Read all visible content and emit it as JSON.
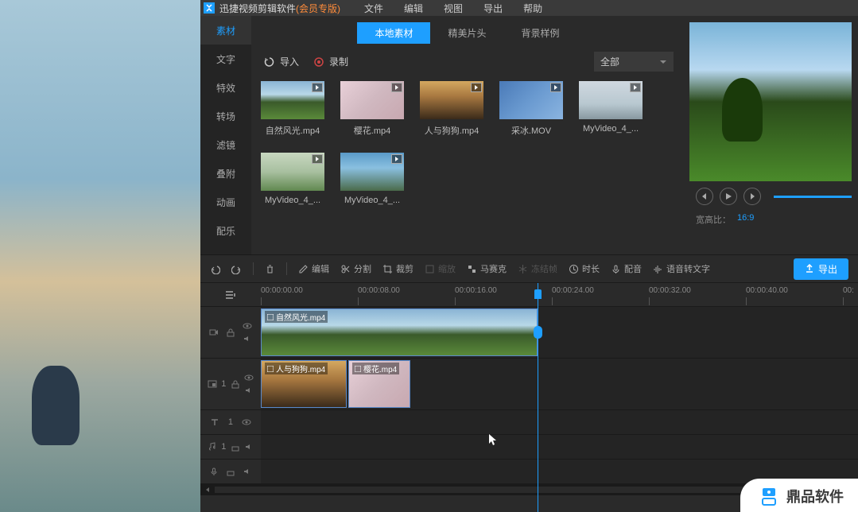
{
  "titlebar": {
    "app_name": "迅捷视频剪辑软件",
    "member": " (会员专版)"
  },
  "menu": [
    "文件",
    "编辑",
    "视图",
    "导出",
    "帮助"
  ],
  "sidetabs": [
    "素材",
    "文字",
    "特效",
    "转场",
    "滤镜",
    "叠附",
    "动画",
    "配乐"
  ],
  "subtabs": [
    "本地素材",
    "精美片头",
    "背景样例"
  ],
  "media_toolbar": {
    "import": "导入",
    "record": "录制",
    "filter": "全部"
  },
  "media_items": [
    {
      "label": "自然风光.mp4",
      "thumb": "thumb-nature"
    },
    {
      "label": "樱花.mp4",
      "thumb": "thumb-sakura"
    },
    {
      "label": "人与狗狗.mp4",
      "thumb": "thumb-dog"
    },
    {
      "label": "采冰.MOV",
      "thumb": "thumb-ice"
    },
    {
      "label": "MyVideo_4_...",
      "thumb": "thumb-mv1"
    },
    {
      "label": "MyVideo_4_...",
      "thumb": "thumb-mv2"
    },
    {
      "label": "MyVideo_4_...",
      "thumb": "thumb-mv3"
    }
  ],
  "preview": {
    "aspect_label": "宽高比：",
    "aspect_value": "16:9"
  },
  "toolbar": {
    "edit": "编辑",
    "split": "分割",
    "crop": "裁剪",
    "zoom": "缩放",
    "mosaic": "马赛克",
    "freeze": "冻结帧",
    "duration": "时长",
    "dub": "配音",
    "stt": "语音转文字",
    "export": "导出"
  },
  "timeline": {
    "ticks": [
      "00:00:00.00",
      "00:00:08.00",
      "00:00:16.00",
      "00:00:24.00",
      "00:00:32.00",
      "00:00:40.00",
      "00:"
    ],
    "clips": {
      "v1": {
        "label": "自然风光.mp4"
      },
      "v2a": {
        "label": "人与狗狗.mp4"
      },
      "v2b": {
        "label": "樱花.mp4"
      }
    },
    "track_num": "1"
  },
  "watermark": "鼎品软件"
}
